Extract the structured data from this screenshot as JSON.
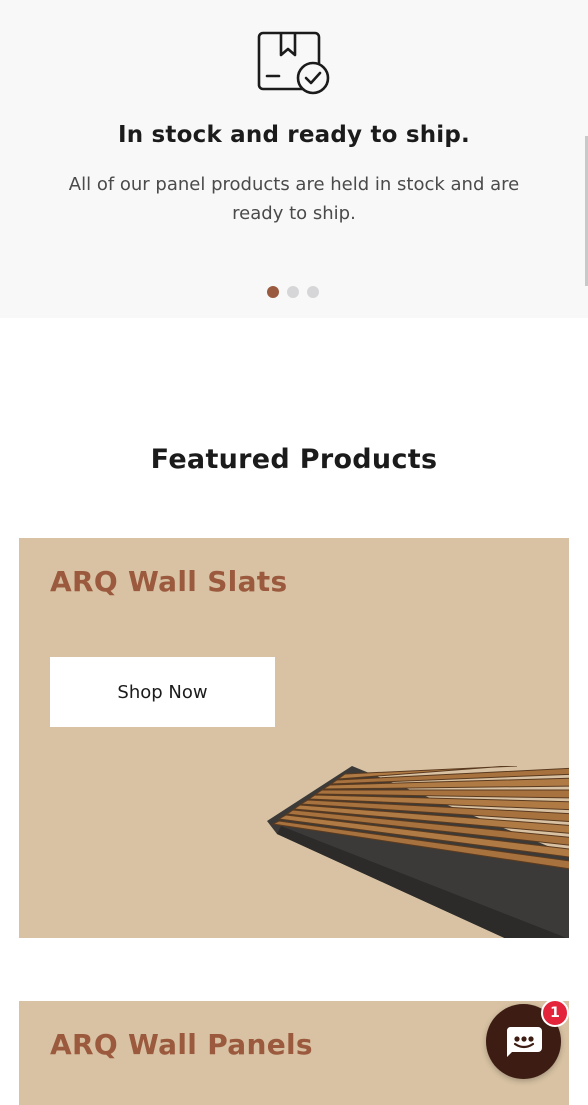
{
  "hero": {
    "icon": "package-check-icon",
    "title": "In stock and ready to ship.",
    "description": "All of our panel products are held in stock and are ready to ship.",
    "carousel": {
      "total": 3,
      "active_index": 0
    }
  },
  "featured": {
    "title": "Featured Products",
    "cards": [
      {
        "title": "ARQ Wall Slats",
        "button_label": "Shop Now",
        "image": "wood-slat-panel"
      },
      {
        "title": "ARQ Wall Panels"
      }
    ]
  },
  "chat": {
    "icon": "chat-bubble-icon",
    "badge_count": "1"
  },
  "colors": {
    "accent": "#9b5a3e",
    "card_bg": "#d8c2a3",
    "chat_bg": "#3d1d13",
    "badge": "#e3243b"
  }
}
